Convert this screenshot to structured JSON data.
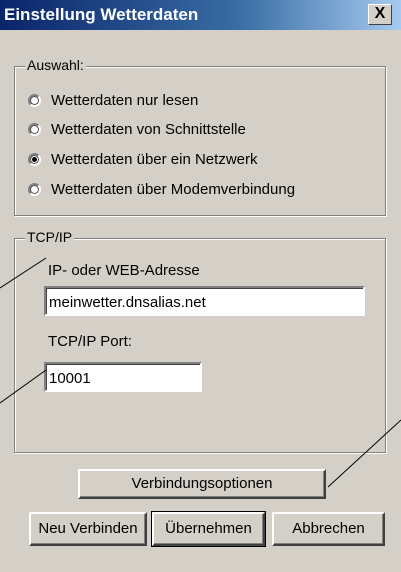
{
  "window": {
    "title": "Einstellung Wetterdaten",
    "close_label": "X"
  },
  "auswahl": {
    "legend": "Auswahl:",
    "options": [
      {
        "label": "Wetterdaten nur lesen",
        "selected": false
      },
      {
        "label": "Wetterdaten von Schnittstelle",
        "selected": false
      },
      {
        "label": "Wetterdaten über ein Netzwerk",
        "selected": true
      },
      {
        "label": "Wetterdaten über Modemverbindung",
        "selected": false
      }
    ]
  },
  "tcpip": {
    "legend": "TCP/IP",
    "address_label": "IP- oder WEB-Adresse",
    "address_value": "meinwetter.dnsalias.net",
    "port_label": "TCP/IP Port:",
    "port_value": "10001"
  },
  "buttons": {
    "verbindungsoptionen": "Verbindungsoptionen",
    "neu_verbinden": "Neu Verbinden",
    "uebernehmen": "Übernehmen",
    "abbrechen": "Abbrechen"
  }
}
